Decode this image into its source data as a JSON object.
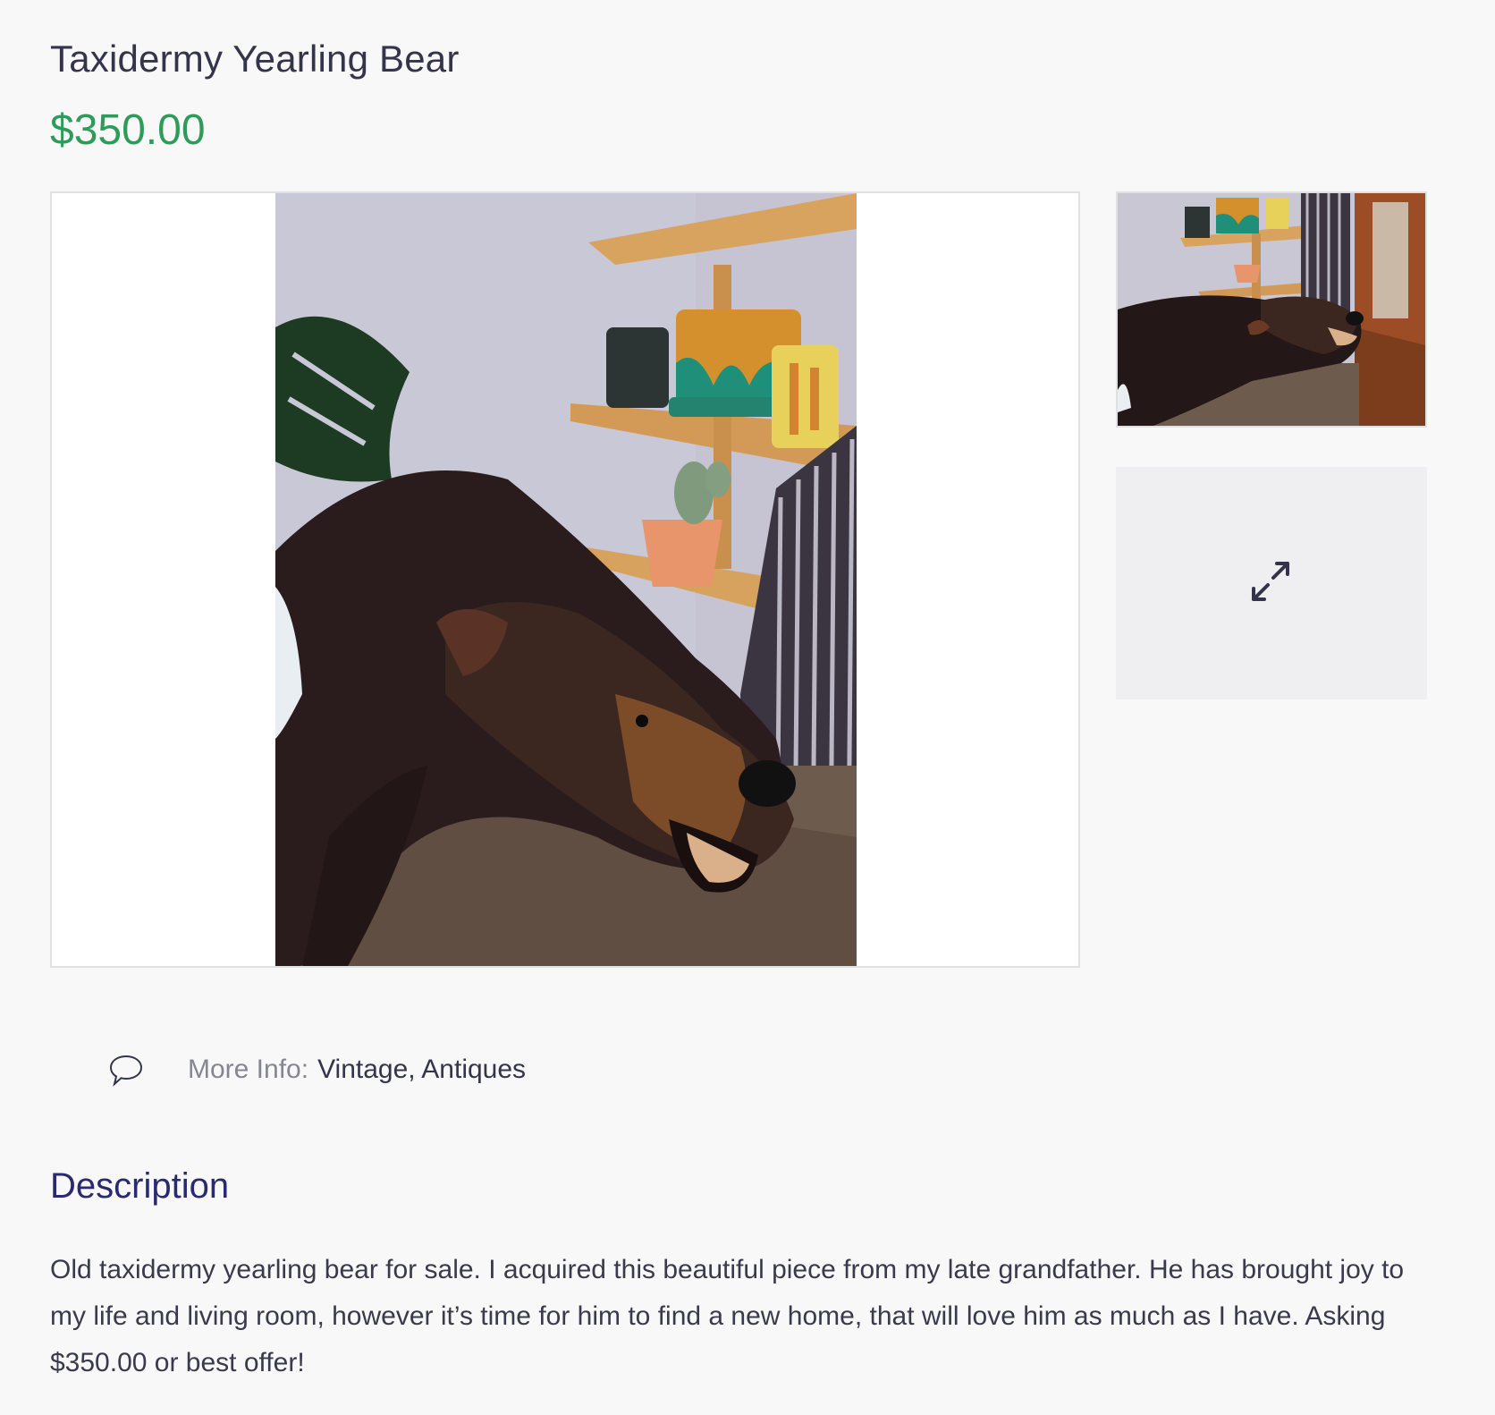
{
  "listing": {
    "title": "Taxidermy Yearling Bear",
    "price": "$350.00"
  },
  "gallery": {
    "main_image": "photo of taxidermy bear beside shelves with potted plants",
    "thumbnail": "thumbnail of taxidermy bear by window",
    "expand_icon": "expand-arrows-icon"
  },
  "more_info": {
    "icon": "speech-bubble-icon",
    "label": "More Info:",
    "value": "Vintage, Antiques"
  },
  "description": {
    "heading": "Description",
    "body": "Old taxidermy yearling bear for sale. I acquired this beautiful piece from my late grandfather. He has brought joy to my life and living room, however it’s time for him to find a new home, that will love him as much as I have. Asking $350.00 or best offer!"
  },
  "colors": {
    "price": "#2e9c59",
    "heading": "#2a2a6e",
    "text": "#34344a",
    "muted": "#868693",
    "background": "#f8f8f9"
  }
}
